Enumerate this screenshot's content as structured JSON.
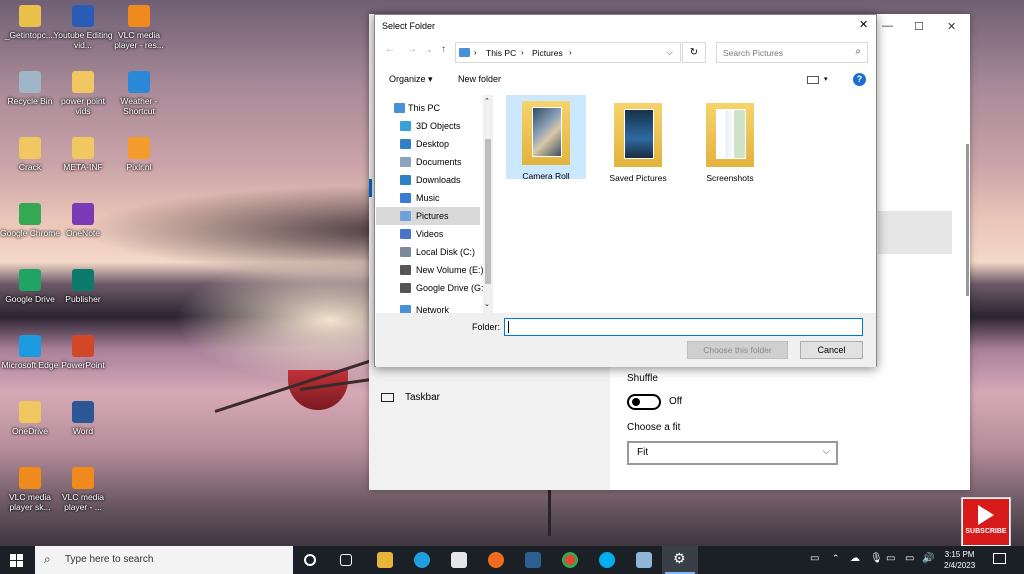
{
  "desktop": {
    "icons": [
      {
        "label": "_Getintopc....",
        "color": "#e8c04a"
      },
      {
        "label": "Recycle Bin",
        "color": "#9fb6c8"
      },
      {
        "label": "Crack",
        "color": "#f0c760"
      },
      {
        "label": "Google Chrome",
        "color": "#34a853"
      },
      {
        "label": "Google Drive",
        "color": "#1fa463"
      },
      {
        "label": "Microsoft Edge",
        "color": "#1c9be0"
      },
      {
        "label": "OneDrive",
        "color": "#f0c760"
      },
      {
        "label": "VLC media player sk...",
        "color": "#f08a1c"
      },
      {
        "label": "Youtube Editing vid...",
        "color": "#2b5db6"
      },
      {
        "label": "power point vids",
        "color": "#f0c760"
      },
      {
        "label": "META-INF",
        "color": "#f0c760"
      },
      {
        "label": "OneNote",
        "color": "#7b3ab5"
      },
      {
        "label": "Publisher",
        "color": "#0e7a6d"
      },
      {
        "label": "PowerPoint",
        "color": "#d24726"
      },
      {
        "label": "Word",
        "color": "#2b5797"
      },
      {
        "label": "VLC media player - ...",
        "color": "#f08a1c"
      },
      {
        "label": "VLC media player - res...",
        "color": "#f08a1c"
      },
      {
        "label": "Weather - Shortcut",
        "color": "#2b88d8"
      },
      {
        "label": "Pixlr.nl",
        "color": "#f39b2d"
      }
    ]
  },
  "settings": {
    "taskbar_label": "Taskbar",
    "shuffle_label": "Shuffle",
    "shuffle_state": "Off",
    "fit_label": "Choose a fit",
    "fit_value": "Fit",
    "minimize": "—",
    "maximize": "☐",
    "close": "✕"
  },
  "dialog": {
    "title": "Select Folder",
    "close": "✕",
    "breadcrumb": [
      "This PC",
      "Pictures"
    ],
    "search_placeholder": "Search Pictures",
    "organize": "Organize ▾",
    "new_folder": "New folder",
    "help": "?",
    "nav_items": [
      {
        "label": "This PC",
        "color": "#4a90d9"
      },
      {
        "label": "3D Objects",
        "color": "#3aa0d8"
      },
      {
        "label": "Desktop",
        "color": "#2f80c8"
      },
      {
        "label": "Documents",
        "color": "#8aa4c0"
      },
      {
        "label": "Downloads",
        "color": "#2f80c8"
      },
      {
        "label": "Music",
        "color": "#3b7bd1"
      },
      {
        "label": "Pictures",
        "color": "#6ea3d8"
      },
      {
        "label": "Videos",
        "color": "#4a74c8"
      },
      {
        "label": "Local Disk (C:)",
        "color": "#7a8a99"
      },
      {
        "label": "New Volume (E:)",
        "color": "#555"
      },
      {
        "label": "Google Drive (G:)",
        "color": "#555"
      },
      {
        "label": "Network",
        "color": "#4a90d9"
      }
    ],
    "folders": [
      {
        "label": "Camera Roll"
      },
      {
        "label": "Saved Pictures"
      },
      {
        "label": "Screenshots"
      }
    ],
    "folder_label": "Folder:",
    "folder_value": "",
    "choose_button": "Choose this folder",
    "cancel_button": "Cancel"
  },
  "taskbar": {
    "search_placeholder": "Type here to search",
    "time": "3:15 PM",
    "date": "2/4/2023"
  },
  "overlay": {
    "subscribe": "SUBSCRIBE"
  }
}
